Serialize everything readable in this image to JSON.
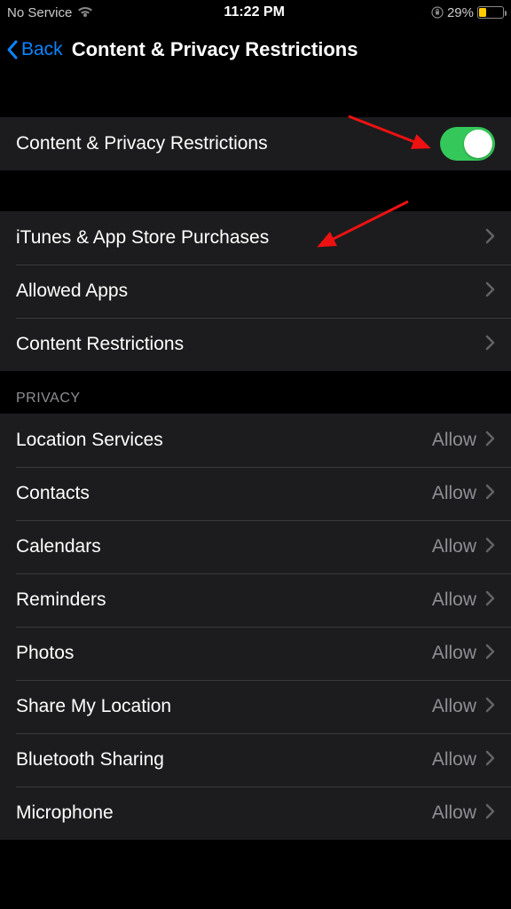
{
  "status": {
    "carrier": "No Service",
    "time": "11:22 PM",
    "battery_percent": "29%"
  },
  "nav": {
    "back_label": "Back",
    "title": "Content & Privacy Restrictions"
  },
  "toggle_row": {
    "label": "Content & Privacy Restrictions",
    "on": true
  },
  "main_rows": [
    {
      "label": "iTunes & App Store Purchases"
    },
    {
      "label": "Allowed Apps"
    },
    {
      "label": "Content Restrictions"
    }
  ],
  "privacy": {
    "header": "PRIVACY",
    "rows": [
      {
        "label": "Location Services",
        "value": "Allow"
      },
      {
        "label": "Contacts",
        "value": "Allow"
      },
      {
        "label": "Calendars",
        "value": "Allow"
      },
      {
        "label": "Reminders",
        "value": "Allow"
      },
      {
        "label": "Photos",
        "value": "Allow"
      },
      {
        "label": "Share My Location",
        "value": "Allow"
      },
      {
        "label": "Bluetooth Sharing",
        "value": "Allow"
      },
      {
        "label": "Microphone",
        "value": "Allow"
      }
    ]
  }
}
